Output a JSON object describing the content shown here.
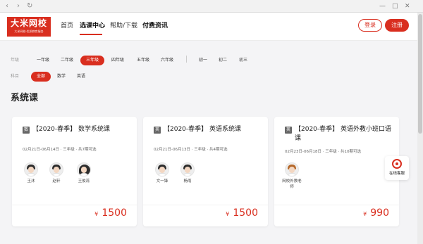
{
  "browser": {
    "back_icon": "chevron-left-icon",
    "forward_icon": "chevron-right-icon",
    "reload_icon": "reload-icon",
    "window_controls": [
      "minimize-icon",
      "maximize-icon",
      "close-icon"
    ]
  },
  "header": {
    "logo_main": "大米网校",
    "logo_sub": "大米网校·优质教育服务",
    "nav": [
      "首页",
      "选课中心",
      "帮助/下载",
      "付费资讯"
    ],
    "active_nav": "选课中心",
    "login": "登录",
    "register": "注册"
  },
  "filters": {
    "grade_label": "年级",
    "grades": [
      "一年级",
      "二年级",
      "三年级",
      "四年级",
      "五年级",
      "六年级",
      "初一",
      "初二",
      "初三"
    ],
    "selected_grade": "三年级",
    "subject_label": "科目",
    "subjects": [
      "全部",
      "数学",
      "英语"
    ],
    "selected_subject": "全部"
  },
  "section_title": "系统课",
  "courses": [
    {
      "badge": "数",
      "title": "【2020-春季】 数学系统课",
      "meta": "02月21日-06月14日 · 三年级 · 共7期可选",
      "teachers": [
        "王沐",
        "赵轩",
        "王俊蕊"
      ],
      "currency": "¥",
      "price": "1500"
    },
    {
      "badge": "英",
      "title": "【2020-春季】 英语系统课",
      "meta": "02月21日-06月13日 · 三年级 · 共4期可选",
      "teachers": [
        "文一锋",
        "杨雨"
      ],
      "currency": "¥",
      "price": "1500"
    },
    {
      "badge": "英",
      "title": "【2020-春季】 英语外教小班口语课",
      "meta": "02月23日-06月18日 · 三年级 · 共10期可选",
      "teachers": [
        "网校外教老师"
      ],
      "currency": "¥",
      "price": "990"
    }
  ],
  "service": {
    "label": "在线客服",
    "icon": "headset-icon"
  },
  "colors": {
    "accent": "#d92e1f",
    "background": "#f4f4f6"
  }
}
